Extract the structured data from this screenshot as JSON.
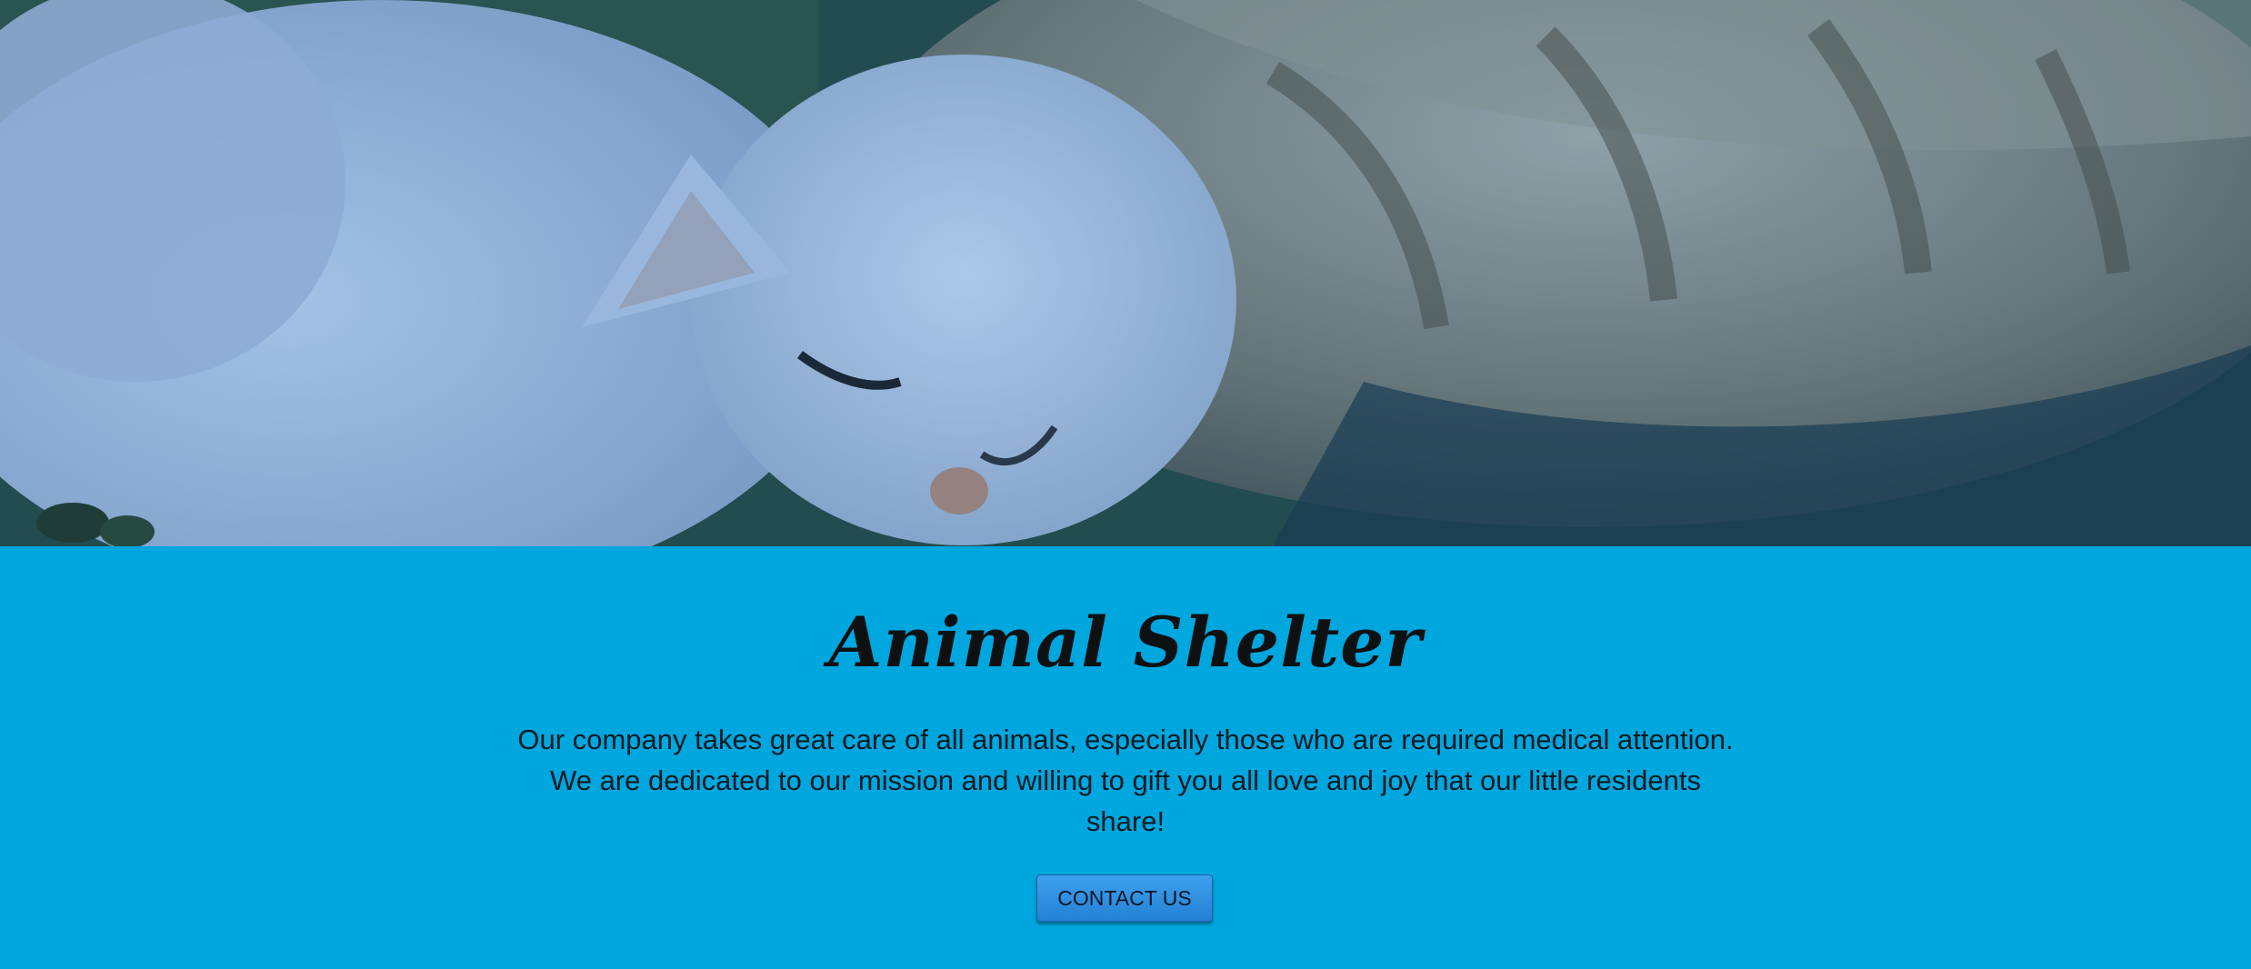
{
  "hero": {
    "image_subject": "cat-and-kitten-photo"
  },
  "content": {
    "title": "Animal Shelter",
    "description": "Our company takes great care of all animals, especially those who are required medical attention. We are dedicated to our mission and willing to gift you all love and joy that our little residents share!",
    "contact_label": "CONTACT US"
  },
  "colors": {
    "band_background": "#00a6de",
    "button_background": "#2a8be0",
    "title_text": "#0d1112"
  }
}
